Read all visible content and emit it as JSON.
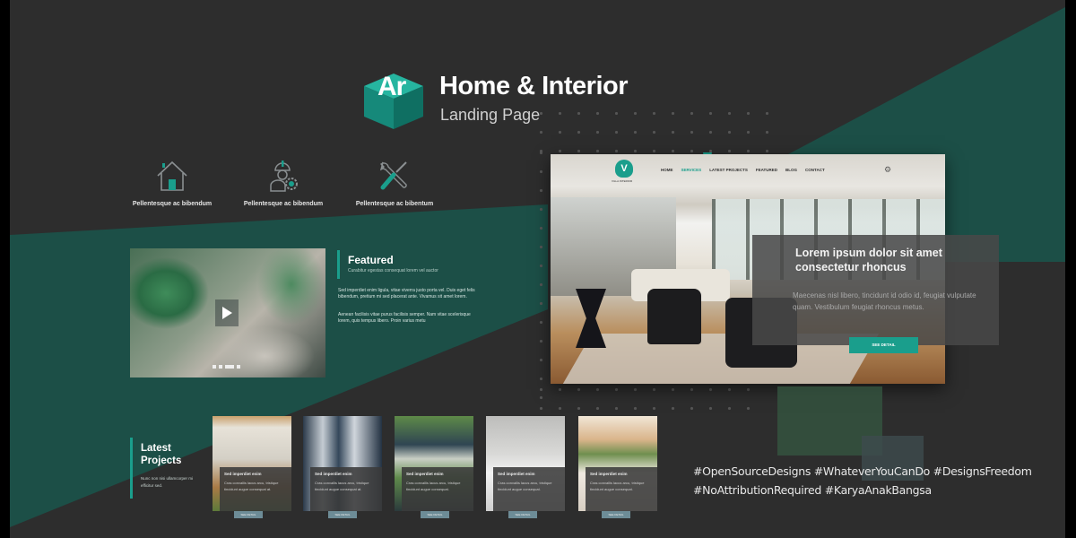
{
  "colors": {
    "background": "#2d2d2d",
    "teal_dark": "#1c4f47",
    "accent": "#1a9e8c",
    "button_muted": "#6d8c97"
  },
  "header": {
    "logo_text": "Ar",
    "title": "Home & Interior",
    "subtitle": "Landing Page"
  },
  "features": [
    {
      "icon": "house-icon",
      "label": "Pellentesque ac bibendum"
    },
    {
      "icon": "worker-gear-icon",
      "label": "Pellentesque ac bibendum"
    },
    {
      "icon": "tools-icon",
      "label": "Pellentesque ac bibentum"
    }
  ],
  "featured": {
    "title": "Featured",
    "subtitle": "Curabitur egestas consequat lorem vel auctor",
    "paragraphs": [
      "Sed imperdiet enim ligula, vitae viverra justo porta vel. Duis eget felis bibendum, pretium mi sed placerat ante. Vivamus sit amet lorem.",
      "Aenean facilisis vitae purus facilisis semper. Nam vitae scelerisque lorem, quis tempus libero. Proin varius metu"
    ],
    "slider_dots": 4,
    "slider_active_index": 2
  },
  "mockup": {
    "logo_text": "V",
    "logo_caption": "VILLA INTERIOR",
    "nav": [
      "HOME",
      "SERVICES",
      "LATEST PROJECTS",
      "FEATURED",
      "BLOG",
      "CONTACT"
    ],
    "nav_active": "SERVICES",
    "hero_title": "Lorem ipsum dolor  sit amet consectetur rhoncus",
    "hero_body": "Maecenas nisl libero, tincidunt id odio id, feugiat vulputate quam. Vestibulum feugiat rhoncus metus.",
    "hero_button": "SEE DETAIL"
  },
  "latest_projects": {
    "title_line1": "Latest",
    "title_line2": "Projects",
    "subtitle": "Nunc non nisi ullamcorper mi efficitur sed.",
    "items": [
      {
        "title": "Sed imperdiet enim",
        "desc": "Cras convallis lacus arcu, tristique tincidunt augue consequat at.",
        "button": "SEE DETAIL"
      },
      {
        "title": "Sed imperdiet enim",
        "desc": "Cras convallis lacus arcu, tristique tincidunt augue consequat at.",
        "button": "SEE DETAIL"
      },
      {
        "title": "Sed imperdiet enim",
        "desc": "Cras convallis lacus arcu, tristique tincidunt augue consequat.",
        "button": "SEE DETAIL"
      },
      {
        "title": "Sed imperdiet enim",
        "desc": "Cras convallis lacus arcu, tristique tincidunt augue consequat.",
        "button": "SEE DETAIL"
      },
      {
        "title": "Sed imperdiet enim",
        "desc": "Cras convallis lacus arcu, tristique tincidunt augue consequat.",
        "button": "SEE DETAIL"
      }
    ]
  },
  "hashtags": {
    "line1": "#OpenSourceDesigns #WhateverYouCanDo #DesignsFreedom",
    "line2": "#NoAttributionRequired #KaryaAnakBangsa"
  }
}
